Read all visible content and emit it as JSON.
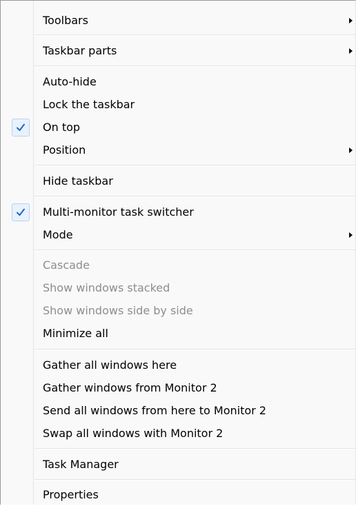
{
  "menu": {
    "items": [
      {
        "label": "Toolbars",
        "submenu": true
      },
      {
        "label": "Taskbar parts",
        "submenu": true
      },
      {
        "label": "Auto-hide"
      },
      {
        "label": "Lock the taskbar"
      },
      {
        "label": "On top",
        "checked": true
      },
      {
        "label": "Position",
        "submenu": true
      },
      {
        "label": "Hide taskbar"
      },
      {
        "label": "Multi-monitor task switcher",
        "checked": true
      },
      {
        "label": "Mode",
        "submenu": true
      },
      {
        "label": "Cascade",
        "disabled": true
      },
      {
        "label": "Show windows stacked",
        "disabled": true
      },
      {
        "label": "Show windows side by side",
        "disabled": true
      },
      {
        "label": "Minimize all"
      },
      {
        "label": "Gather all windows here"
      },
      {
        "label": "Gather windows from Monitor 2"
      },
      {
        "label": "Send all windows from here to Monitor 2"
      },
      {
        "label": "Swap all windows with Monitor 2"
      },
      {
        "label": "Task Manager"
      },
      {
        "label": "Properties"
      }
    ]
  },
  "colors": {
    "menu_background": "#f9f9f9",
    "check_mark": "#1f66c9",
    "disabled_text": "#8d8d8d"
  }
}
